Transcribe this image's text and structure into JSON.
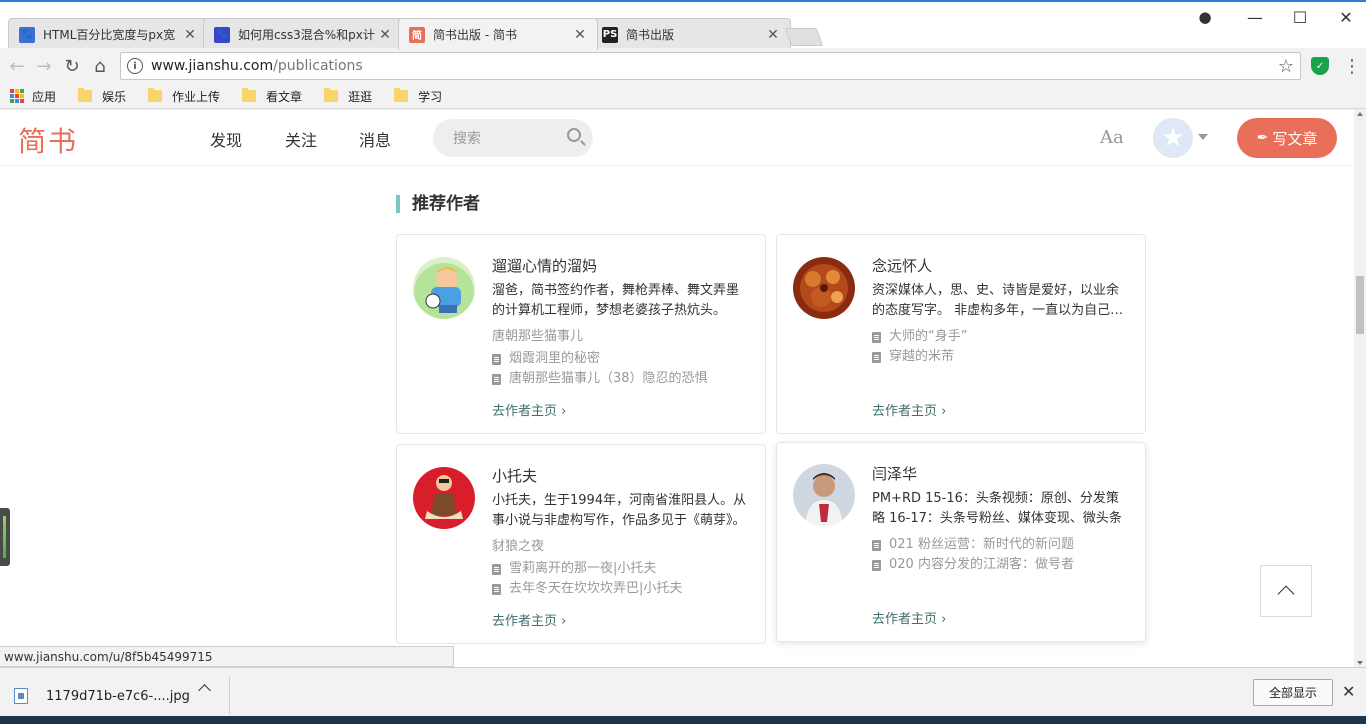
{
  "browser": {
    "tabs": [
      {
        "title": "HTML百分比宽度与px宽",
        "favicon": "baidu-paw-icon",
        "color": "#3a6fd8"
      },
      {
        "title": "如何用css3混合%和px计",
        "favicon": "baidu-paw-icon",
        "color": "#3a45c8"
      },
      {
        "title": "简书出版 - 简书",
        "favicon": "jianshu-icon",
        "color": "#ea6f5a"
      },
      {
        "title": "简书出版",
        "favicon": "ps-icon",
        "color": "#222222"
      }
    ],
    "address": {
      "host": "www.jianshu.com",
      "path": "/publications"
    },
    "bookmarks": {
      "apps": "应用",
      "folders": [
        "娱乐",
        "作业上传",
        "看文章",
        "逛逛",
        "学习"
      ]
    },
    "status_url": "www.jianshu.com/u/8f5b45499715",
    "download": {
      "filename": "1179d71b-e7c6-....jpg",
      "show_all": "全部显示"
    }
  },
  "site": {
    "logo": "简书",
    "nav": [
      "发现",
      "关注",
      "消息"
    ],
    "search_placeholder": "搜索",
    "font_toggle": "Aa",
    "write_button": "写文章",
    "accent": "#ea6f5a"
  },
  "section": {
    "title": "推荐作者",
    "more_label": "去作者主页 ›",
    "authors": [
      {
        "name": "遛遛心情的溜妈",
        "desc": "溜爸，简书签约作者，舞枪弄棒、舞文弄墨的计算机工程师，梦想老婆孩子热炕头。",
        "sub": "唐朝那些猫事儿",
        "notes": [
          "烟霞洞里的秘密",
          "唐朝那些猫事儿（38）隐忍的恐惧"
        ]
      },
      {
        "name": "念远怀人",
        "desc": "资深媒体人，思、史、诗皆是爱好，以业余的态度写字。 非虚构多年，一直以为自己是写实派。",
        "sub": "",
        "notes": [
          "大师的“身手”",
          "穿越的米芾"
        ]
      },
      {
        "name": "小托夫",
        "desc": "小托夫，生于1994年，河南省淮阳县人。从事小说与非虚构写作，作品多见于《萌芽》。",
        "sub": "豺狼之夜",
        "notes": [
          "雪莉离开的那一夜|小托夫",
          "去年冬天在坎坎坎弄巴|小托夫"
        ]
      },
      {
        "name": "闫泽华",
        "desc": "PM+RD 15-16：头条视频：原创、分发策略 16-17：头条号粉丝、媒体变现、微头条",
        "sub": "",
        "notes": [
          "021 粉丝运营：新时代的新问题",
          "020 内容分发的江湖客：做号者"
        ]
      }
    ]
  }
}
